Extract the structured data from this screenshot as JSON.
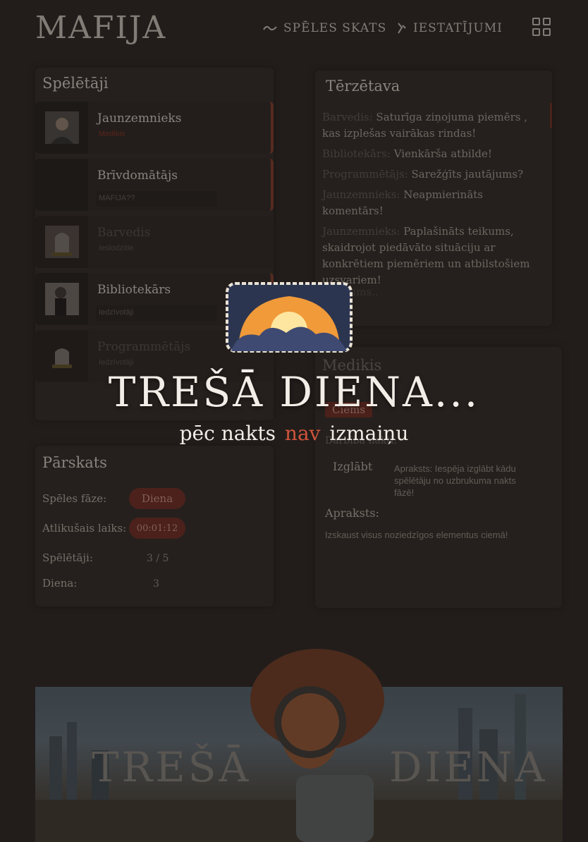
{
  "header": {
    "logo": "MAFIJA",
    "nav_game": "SPĒLES SKATS",
    "nav_settings": "IESTATĪJUMI"
  },
  "players_panel": {
    "title": "Spēlētāji",
    "players": [
      {
        "name": "Jaunzemnieks",
        "role": "Medikis",
        "status": "alive",
        "avatar": "portrait"
      },
      {
        "name": "Brīvdomātājs",
        "role": "MAFIJA??",
        "status": "alive",
        "avatar": "empty"
      },
      {
        "name": "Barvedis",
        "role": "Ieslodzītie",
        "status": "dead",
        "avatar": "rip"
      },
      {
        "name": "Bibliotekārs",
        "role": "Iedzīvotāji",
        "status": "alive",
        "avatar": "portrait"
      },
      {
        "name": "Programmētājs",
        "role": "Iedzīvotāji",
        "status": "dead",
        "avatar": "rip"
      }
    ]
  },
  "overview": {
    "title": "Pārskats",
    "phase_label": "Spēles fāze:",
    "phase_value": "Diena",
    "time_label": "Atlikušais laiks:",
    "time_value": "00:01:12",
    "players_label": "Spēlētāji:",
    "players_value": "3 / 5",
    "day_label": "Diena:",
    "day_value": "3"
  },
  "chat": {
    "title": "Tērzētava",
    "messages": [
      {
        "author": "Barvedis:",
        "text": "Saturīga ziņojuma piemērs , kas izplešas vairākas rindas!"
      },
      {
        "author": "Bibliotekārs:",
        "text": "Vienkārša atbilde!"
      },
      {
        "author": "Programmētājs:",
        "text": "Sarežģīts jautājums?"
      },
      {
        "author": "Jaunzemnieks:",
        "text": "Neapmierināts komentārs!"
      },
      {
        "author": "Jaunzemnieks:",
        "text": "Paplašināts teikums, skaidrojot piedāvāto situāciju ar konkrētiem piemēriem un atbilstošiem uzsvariem!"
      }
    ],
    "input_placeholder": "Ziņojums.."
  },
  "role_panel": {
    "role_name": "Medikis",
    "badge": "Ciems",
    "actions_label": "Darbība naktī:",
    "action_name": "Izglābt",
    "action_desc": "Apraksts: Iespēja izglābt kādu spēlētāju no uzbrukuma nakts fāzē!",
    "desc_label": "Apraksts:",
    "desc_text": "Izskaust visus noziedzīgos elementus ciemā!"
  },
  "banner": {
    "left_text": "TREŠĀ",
    "right_text": "DIENA"
  },
  "overlay": {
    "title": "TREŠĀ DIENA...",
    "sub_before": "pēc nakts",
    "sub_highlight": "nav",
    "sub_after": "izmaiņu"
  },
  "colors": {
    "accent": "#d0543a",
    "badge": "#6b2a22",
    "background": "#2a2422"
  }
}
